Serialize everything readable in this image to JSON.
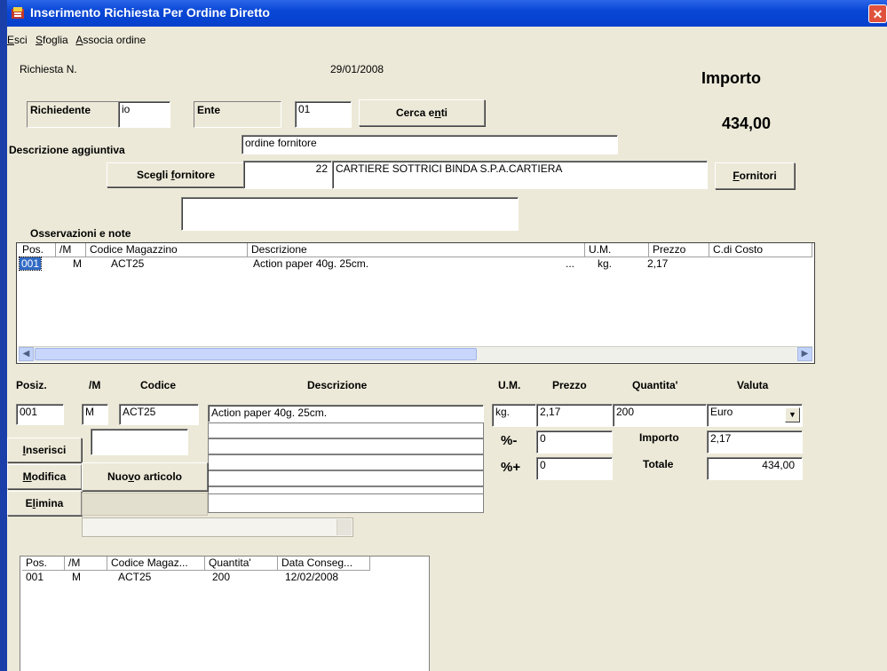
{
  "window": {
    "title": "Inserimento Richiesta Per Ordine Diretto"
  },
  "menu": [
    {
      "label": "Esci",
      "key": "E",
      "rest": "sci"
    },
    {
      "label": "Sfoglia",
      "key": "S",
      "rest": "foglia"
    },
    {
      "label": "Associa ordine",
      "key": "A",
      "rest": "ssocia ordine"
    }
  ],
  "header": {
    "richiesta_label": "Richiesta N.",
    "date": "29/01/2008",
    "importo_label": "Importo",
    "importo_value": "434,00",
    "richiedente_label": "Richiedente",
    "richiedente_value": "io",
    "ente_label": "Ente",
    "ente_value": "01",
    "cerca_pre": "Cerca e",
    "cerca_key": "n",
    "cerca_post": "ti",
    "descrizione_aggiuntiva_label": "Descrizione aggiuntiva",
    "descrizione_aggiuntiva_value": "ordine fornitore",
    "scegli_pre": "Scegli ",
    "scegli_key": "f",
    "scegli_post": "ornitore",
    "fornitore_code": "22",
    "fornitore_name": "CARTIERE SOTTRICI BINDA S.P.A.CARTIERA",
    "fornitori_key": "F",
    "fornitori_post": "ornitori",
    "osservazioni_label": "Osservazioni e note",
    "osservazioni_value": ""
  },
  "top_grid": {
    "columns": [
      "Pos.",
      "/M",
      "Codice Magazzino",
      "Descrizione",
      "U.M.",
      "Prezzo",
      "C.di Costo"
    ],
    "rows": [
      {
        "pos": "001",
        "m": "M",
        "codice": "ACT25",
        "descrizione": "Action paper 40g. 25cm.",
        "ellipsis": "...",
        "um": "kg.",
        "prezzo": "2,17",
        "costo": ""
      }
    ]
  },
  "detail": {
    "posiz_label": "Posiz.",
    "m_label": "/M",
    "codice_label": "Codice",
    "descrizione_label": "Descrizione",
    "um_label": "U.M.",
    "prezzo_label": "Prezzo",
    "quantita_label": "Quantita'",
    "valuta_label": "Valuta",
    "posiz_value": "001",
    "m_value": "M",
    "codice_value": "ACT25",
    "descrizione_value": "Action paper 40g. 25cm.",
    "um_value": "kg.",
    "prezzo_value": "2,17",
    "quantita_value": "200",
    "valuta_value": "Euro",
    "sconto_label": "%-",
    "sconto_value": "0",
    "maggiorazione_label": "%+",
    "maggiorazione_value": "0",
    "importo_label": "Importo",
    "importo_value": "2,17",
    "totale_label": "Totale",
    "totale_value": "434,00",
    "inserisci_key": "I",
    "inserisci_post": "nserisci",
    "modifica_key": "M",
    "modifica_post": "odifica",
    "elimina_pre": "E",
    "elimina_key": "l",
    "elimina_post": "imina",
    "nuovo_pre": "Nuo",
    "nuovo_key": "v",
    "nuovo_post": "o articolo"
  },
  "bottom_grid": {
    "columns": [
      "Pos.",
      "/M",
      "Codice Magaz...",
      "Quantita'",
      "Data Conseg..."
    ],
    "rows": [
      {
        "pos": "001",
        "m": "M",
        "codice": "ACT25",
        "quantita": "200",
        "data": "12/02/2008"
      }
    ]
  },
  "colors": {
    "titlebar": "#0a47d6",
    "window_bg": "#ece9d8",
    "selection": "#316ac5"
  }
}
